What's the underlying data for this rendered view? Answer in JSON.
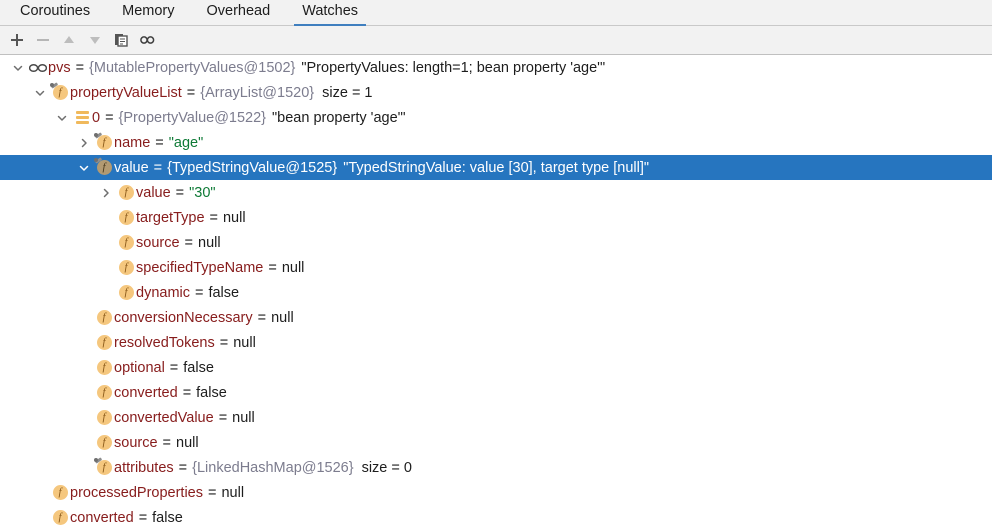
{
  "tabs": [
    {
      "label": "Coroutines",
      "active": false
    },
    {
      "label": "Memory",
      "active": false
    },
    {
      "label": "Overhead",
      "active": false
    },
    {
      "label": "Watches",
      "active": true
    }
  ],
  "toolbar": {
    "buttons": [
      {
        "name": "add-watch-button",
        "icon": "plus-icon",
        "enabled": true
      },
      {
        "name": "remove-watch-button",
        "icon": "minus-icon",
        "enabled": false
      },
      {
        "name": "move-watch-up-button",
        "icon": "arrow-up-icon",
        "enabled": false
      },
      {
        "name": "move-watch-down-button",
        "icon": "arrow-down-icon",
        "enabled": false
      },
      {
        "name": "duplicate-watch-button",
        "icon": "copy-icon",
        "enabled": true
      },
      {
        "name": "inspect-button",
        "icon": "glasses-icon",
        "enabled": true
      }
    ]
  },
  "tree": {
    "rows": [
      {
        "indent": 0,
        "twisty": "expanded",
        "icon": "watch-glasses-icon",
        "selected": false,
        "name": "pvs",
        "eq": "=",
        "type": "{MutablePropertyValues@1502}",
        "value": "\"PropertyValues: length=1; bean property 'age'\"",
        "value_kind": "plain",
        "extra": ""
      },
      {
        "indent": 1,
        "twisty": "expanded",
        "icon": "field-final-icon",
        "selected": false,
        "name": "propertyValueList",
        "eq": "=",
        "type": "{ArrayList@1520}",
        "value": "",
        "value_kind": "plain",
        "extra": "size = 1"
      },
      {
        "indent": 2,
        "twisty": "expanded",
        "icon": "list-element-icon",
        "selected": false,
        "name": "0",
        "eq": "=",
        "type": "{PropertyValue@1522}",
        "value": "\"bean property 'age'\"",
        "value_kind": "plain",
        "extra": ""
      },
      {
        "indent": 3,
        "twisty": "collapsed",
        "icon": "field-final-icon",
        "selected": false,
        "name": "name",
        "eq": "=",
        "type": "",
        "value": "\"age\"",
        "value_kind": "string",
        "extra": ""
      },
      {
        "indent": 3,
        "twisty": "expanded",
        "icon": "field-final-icon",
        "selected": true,
        "name": "value",
        "eq": "=",
        "type": "{TypedStringValue@1525}",
        "value": "\"TypedStringValue: value [30], target type [null]\"",
        "value_kind": "plain",
        "extra": ""
      },
      {
        "indent": 4,
        "twisty": "collapsed",
        "icon": "field-icon",
        "selected": false,
        "name": "value",
        "eq": "=",
        "type": "",
        "value": "\"30\"",
        "value_kind": "string",
        "extra": ""
      },
      {
        "indent": 4,
        "twisty": "none",
        "icon": "field-icon",
        "selected": false,
        "name": "targetType",
        "eq": "=",
        "type": "",
        "value": "null",
        "value_kind": "plain",
        "extra": ""
      },
      {
        "indent": 4,
        "twisty": "none",
        "icon": "field-icon",
        "selected": false,
        "name": "source",
        "eq": "=",
        "type": "",
        "value": "null",
        "value_kind": "plain",
        "extra": ""
      },
      {
        "indent": 4,
        "twisty": "none",
        "icon": "field-icon",
        "selected": false,
        "name": "specifiedTypeName",
        "eq": "=",
        "type": "",
        "value": "null",
        "value_kind": "plain",
        "extra": ""
      },
      {
        "indent": 4,
        "twisty": "none",
        "icon": "field-icon",
        "selected": false,
        "name": "dynamic",
        "eq": "=",
        "type": "",
        "value": "false",
        "value_kind": "plain",
        "extra": ""
      },
      {
        "indent": 3,
        "twisty": "none",
        "icon": "field-icon",
        "selected": false,
        "name": "conversionNecessary",
        "eq": "=",
        "type": "",
        "value": "null",
        "value_kind": "plain",
        "extra": ""
      },
      {
        "indent": 3,
        "twisty": "none",
        "icon": "field-icon",
        "selected": false,
        "name": "resolvedTokens",
        "eq": "=",
        "type": "",
        "value": "null",
        "value_kind": "plain",
        "extra": ""
      },
      {
        "indent": 3,
        "twisty": "none",
        "icon": "field-icon",
        "selected": false,
        "name": "optional",
        "eq": "=",
        "type": "",
        "value": "false",
        "value_kind": "plain",
        "extra": ""
      },
      {
        "indent": 3,
        "twisty": "none",
        "icon": "field-icon",
        "selected": false,
        "name": "converted",
        "eq": "=",
        "type": "",
        "value": "false",
        "value_kind": "plain",
        "extra": ""
      },
      {
        "indent": 3,
        "twisty": "none",
        "icon": "field-icon",
        "selected": false,
        "name": "convertedValue",
        "eq": "=",
        "type": "",
        "value": "null",
        "value_kind": "plain",
        "extra": ""
      },
      {
        "indent": 3,
        "twisty": "none",
        "icon": "field-icon",
        "selected": false,
        "name": "source",
        "eq": "=",
        "type": "",
        "value": "null",
        "value_kind": "plain",
        "extra": ""
      },
      {
        "indent": 3,
        "twisty": "none",
        "icon": "field-final-icon",
        "selected": false,
        "name": "attributes",
        "eq": "=",
        "type": "{LinkedHashMap@1526}",
        "value": "",
        "value_kind": "plain",
        "extra": "size = 0"
      },
      {
        "indent": 1,
        "twisty": "none",
        "icon": "field-icon",
        "selected": false,
        "name": "processedProperties",
        "eq": "=",
        "type": "",
        "value": "null",
        "value_kind": "plain",
        "extra": ""
      },
      {
        "indent": 1,
        "twisty": "none",
        "icon": "field-icon",
        "selected": false,
        "name": "converted",
        "eq": "=",
        "type": "",
        "value": "false",
        "value_kind": "plain",
        "extra": ""
      }
    ]
  },
  "colors": {
    "selection": "#2675bf",
    "tab_underline": "#3f7fbf",
    "field_name": "#871c1c",
    "type_ref": "#7c7c8e",
    "string_value": "#0e7a36",
    "toolbar_bg": "#f2f2f2"
  }
}
